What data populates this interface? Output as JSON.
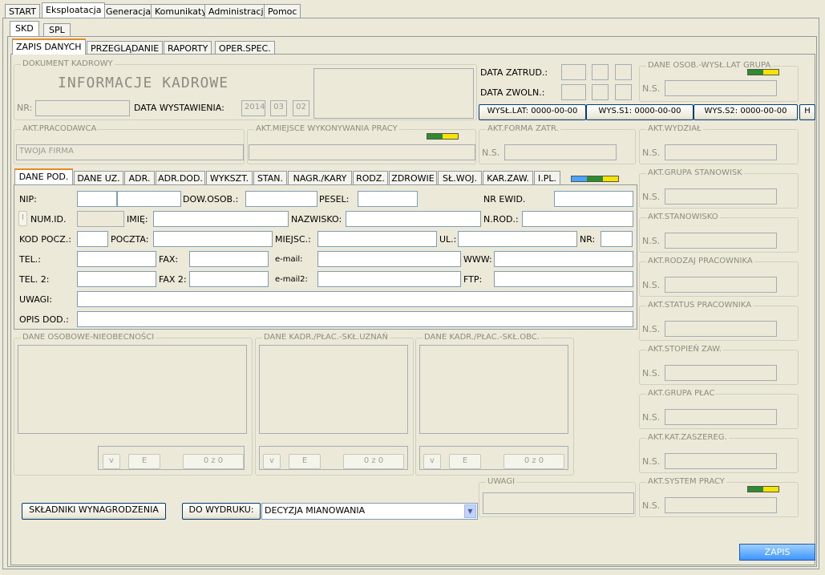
{
  "main_tabs": [
    "START",
    "Eksploatacja",
    "Generacja",
    "Komunikaty",
    "Administracja",
    "Pomoc"
  ],
  "sub_tabs": [
    "SKD",
    "SPL"
  ],
  "section_tabs": [
    "ZAPIS DANYCH",
    "PRZEGLĄDANIE",
    "RAPORTY",
    "OPER.SPEC."
  ],
  "dokument": {
    "group_title": "DOKUMENT KADROWY",
    "heading": "INFORMACJE KADROWE",
    "nr_label": "NR:",
    "date_label": "DATA WYSTAWIENIA:",
    "date_year": "2014",
    "date_month": "03",
    "date_day": "02"
  },
  "dates": {
    "zatrud_label": "DATA ZATRUD.:",
    "zwoln_label": "DATA ZWOLN.:"
  },
  "buttons": {
    "wys_lat": "WYSŁ.LAT: 0000-00-00",
    "wys_s1": "WYS.S1: 0000-00-00",
    "wys_s2": "WYS.S2: 0000-00-00",
    "h": "H",
    "skladniki": "SKŁADNIKI WYNAGRODZENIA",
    "do_wydruku": "DO WYDRUKU:",
    "zapis": "ZAPIS"
  },
  "dane_osob_grupa": {
    "title": "DANE OSOB.-WYSŁ.LAT GRUPA",
    "ns": "N.S."
  },
  "pracodawca": {
    "title": "AKT.PRACODAWCA",
    "value": "TWOJA FIRMA"
  },
  "miejsce": {
    "title": "AKT.MIEJSCE WYKONYWANIA PRACY"
  },
  "forma": {
    "title": "AKT.FORMA ZATR.",
    "ns": "N.S."
  },
  "right_groups": [
    {
      "title": "AKT.WYDZIAŁ",
      "ns": "N.S."
    },
    {
      "title": "AKT.GRUPA STANOWISK",
      "ns": "N.S."
    },
    {
      "title": "AKT.STANOWISKO",
      "ns": "N.S."
    },
    {
      "title": "AKT.RODZAJ PRACOWNIKA",
      "ns": "N.S."
    },
    {
      "title": "AKT.STATUS PRACOWNIKA",
      "ns": "N.S."
    },
    {
      "title": "AKT.STOPIEŃ ZAW.",
      "ns": "N.S."
    },
    {
      "title": "AKT.GRUPA PŁAC",
      "ns": "N.S."
    },
    {
      "title": "AKT.KAT.ZASZEREG.",
      "ns": "N.S."
    },
    {
      "title": "AKT.SYSTEM PRACY",
      "ns": "N.S."
    }
  ],
  "dane_tabs": [
    "DANE POD.",
    "DANE UZ.",
    "ADR.",
    "ADR.DOD.",
    "WYKSZT.",
    "STAN.",
    "NAGR./KARY",
    "RODZ.",
    "ZDROWIE",
    "SŁ.WOJ.",
    "KAR.ZAW.",
    "I.PL."
  ],
  "form": {
    "nip": "NIP:",
    "dow": "DOW.OSOB.:",
    "pesel": "PESEL:",
    "nr_ewid": "NR EWID.",
    "i": "I",
    "num_id": "NUM.ID.",
    "imie": "IMIĘ:",
    "nazwisko": "NAZWISKO:",
    "n_rod": "N.ROD.:",
    "kod": "KOD POCZ.:",
    "poczta": "POCZTA:",
    "miejsc": "MIEJSC.:",
    "ul": "UL.:",
    "nr": "NR:",
    "tel": "TEL.:",
    "fax": "FAX:",
    "email": "e-mail:",
    "www": "WWW:",
    "tel2": "TEL. 2:",
    "fax2": "FAX 2:",
    "email2": "e-mail2:",
    "ftp": "FTP:",
    "uwagi": "UWAGI:",
    "opis": "OPIS DOD.:"
  },
  "bottom_groups": [
    {
      "title": "DANE OSOBOWE-NIEOBECNOŚCI",
      "v": "v",
      "e": "E",
      "count": "0 z 0"
    },
    {
      "title": "DANE KADR./PŁAC.-SKŁ.UZNAŃ",
      "v": "v",
      "e": "E",
      "count": "0 z 0"
    },
    {
      "title": "DANE KADR./PŁAC.-SKŁ.OBC.",
      "v": "v",
      "e": "E",
      "count": "0 z 0"
    }
  ],
  "uwagi_group": "UWAGI",
  "dropdown_value": "DECYZJA MIANOWANIA",
  "colors": {
    "flag_green": "#2e8b2e",
    "flag_yellow": "#f5e400",
    "flag_blue": "#4aa3ff",
    "accent_tab": "#e68b2c"
  }
}
